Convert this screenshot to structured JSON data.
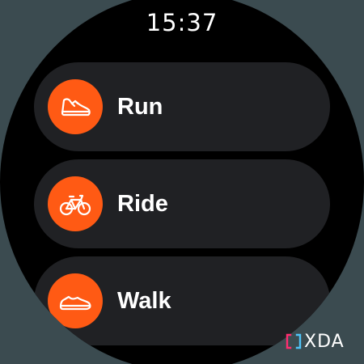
{
  "status": {
    "time": "15:37"
  },
  "activities": [
    {
      "label": "Run",
      "icon": "shoe-icon"
    },
    {
      "label": "Ride",
      "icon": "bicycle-icon"
    },
    {
      "label": "Walk",
      "icon": "sneaker-icon"
    }
  ],
  "watermark": {
    "text": "XDA"
  },
  "colors": {
    "accent": "#ff5a14",
    "chip_background": "#202124",
    "screen_background": "#000000",
    "outer_background": "#3b4b50",
    "watermark_accent": "#ff2d6f"
  }
}
